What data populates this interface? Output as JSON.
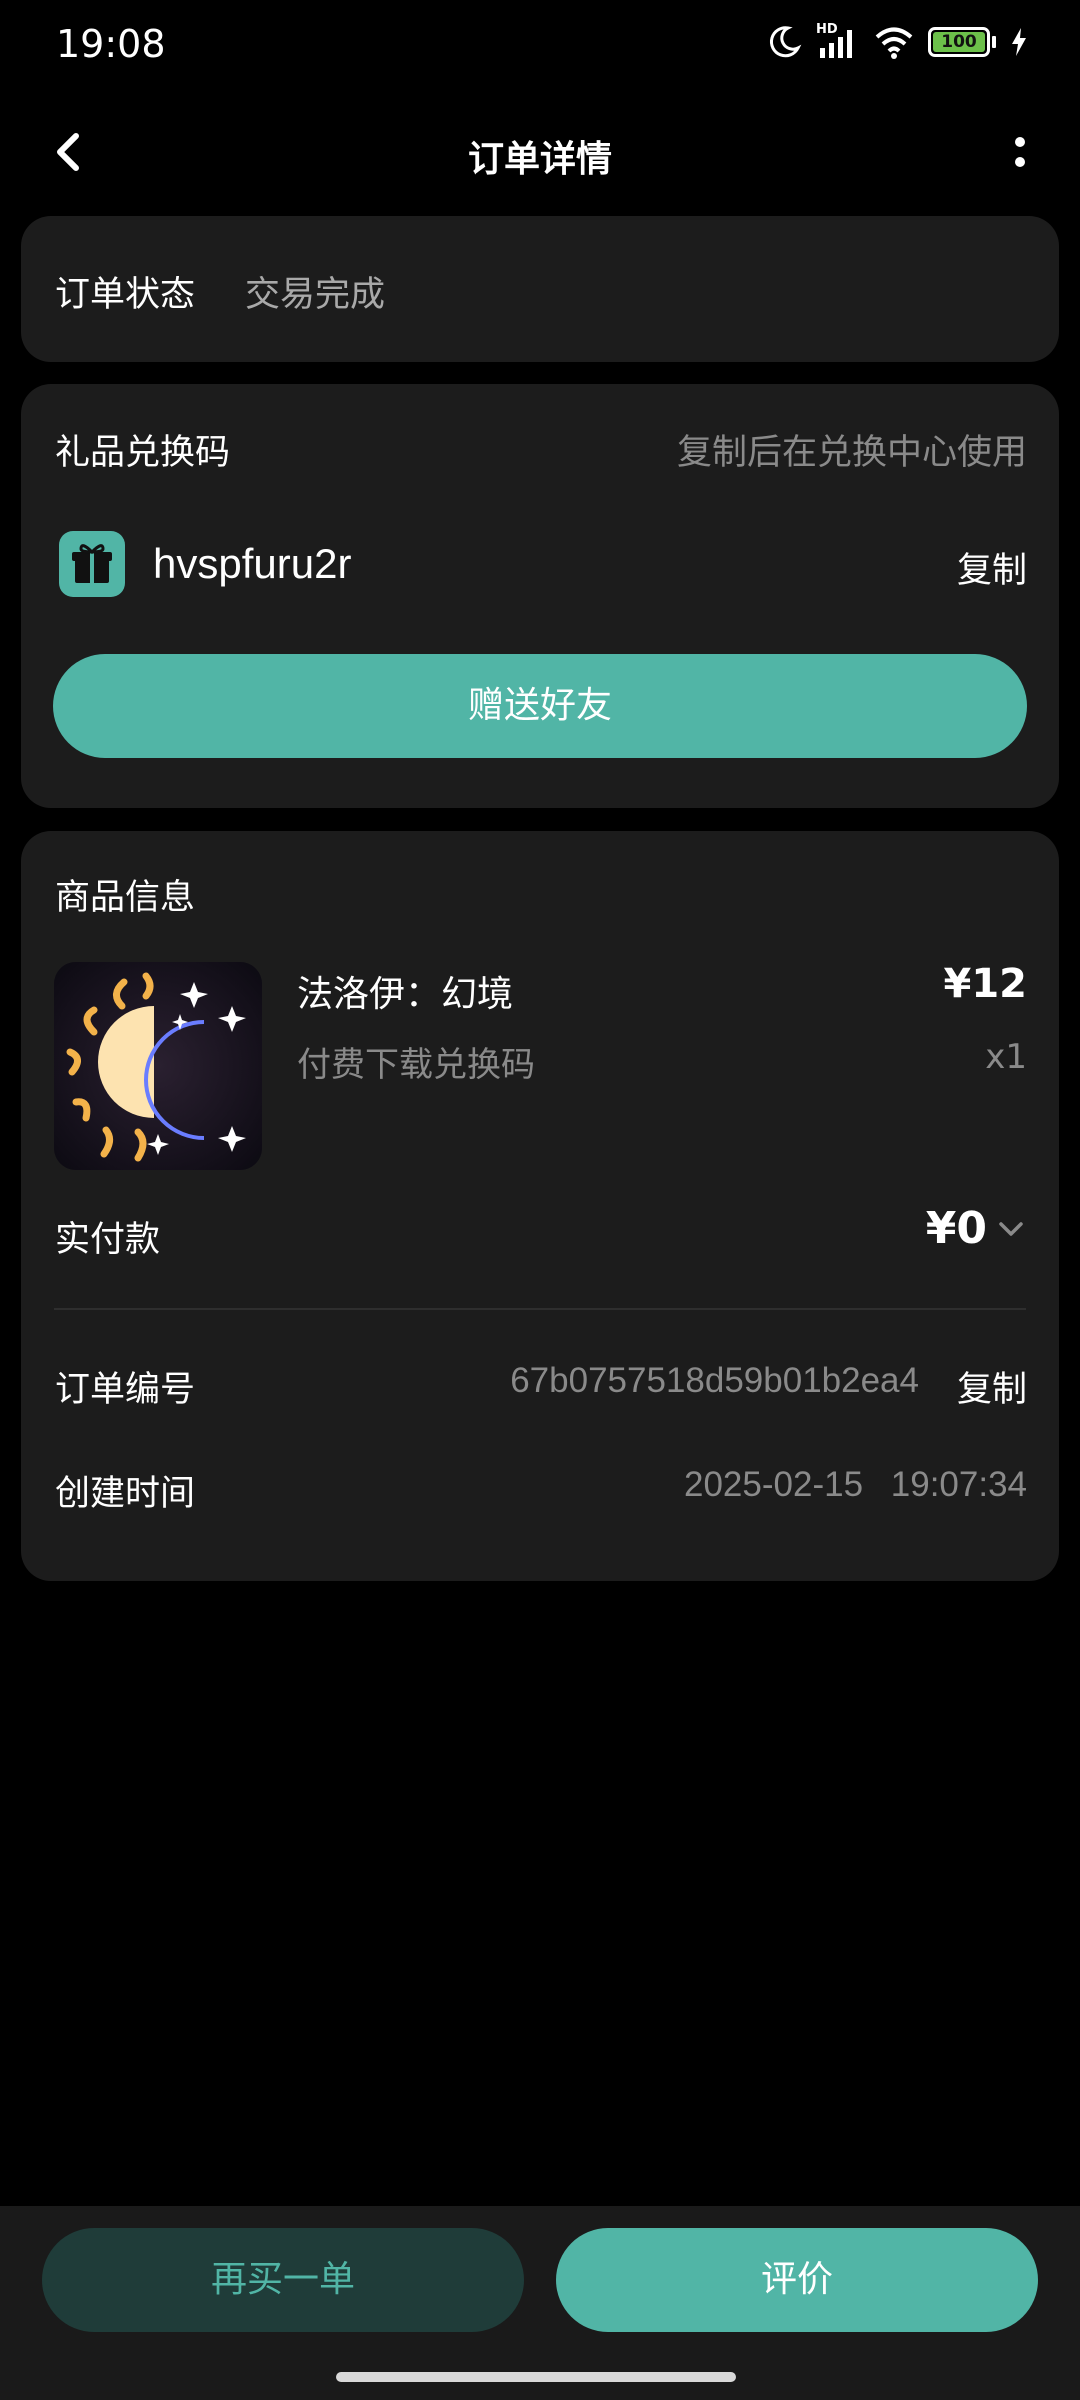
{
  "status_bar": {
    "time": "19:08",
    "network_label": "HD",
    "battery": "100",
    "icons": [
      "moon-icon",
      "signal-icon",
      "wifi-icon",
      "battery-icon",
      "charging-icon"
    ]
  },
  "header": {
    "title": "订单详情",
    "back_icon": "chevron-left-icon",
    "more_icon": "more-vertical-icon"
  },
  "order_status": {
    "label": "订单状态",
    "value": "交易完成"
  },
  "gift_code": {
    "title": "礼品兑换码",
    "hint": "复制后在兑换中心使用",
    "icon": "gift-icon",
    "code": "hvspfuru2r",
    "copy_label": "复制",
    "send_button": "赠送好友"
  },
  "goods": {
    "title": "商品信息",
    "product": {
      "name": "法洛伊：幻境",
      "subtitle": "付费下载兑换码",
      "price": "¥12",
      "quantity": "x1",
      "image": "sun-moon-app-icon"
    },
    "paid": {
      "label": "实付款",
      "value": "¥0"
    },
    "order_number": {
      "label": "订单编号",
      "value": "67b0757518d59b01b2ea4",
      "copy_label": "复制"
    },
    "created_time": {
      "label": "创建时间",
      "value": "2025-02-15 19:07:34"
    }
  },
  "bottom_bar": {
    "rebuy_button": "再买一单",
    "review_button": "评价"
  },
  "colors": {
    "accent": "#51b5a6",
    "card_bg": "#1c1c1c",
    "page_bg": "#000000",
    "muted_text": "#8a8a8a"
  }
}
